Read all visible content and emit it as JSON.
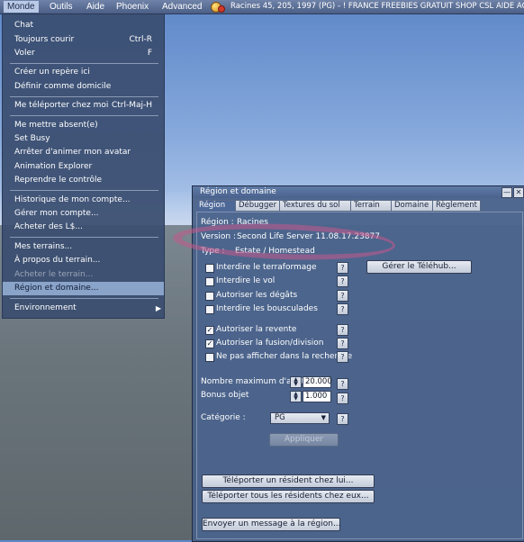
{
  "menubar": {
    "items": [
      "Monde",
      "Outils",
      "Aide",
      "Phoenix",
      "Advanced"
    ],
    "status": "Racines 45, 205, 1997 (PG) - ! FRANCE FREEBIES GRATUIT SHOP CSL AIDE ACCUEIL"
  },
  "monde_menu": {
    "items": [
      {
        "label": "Chat",
        "shortcut": ""
      },
      {
        "label": "Toujours courir",
        "shortcut": "Ctrl-R"
      },
      {
        "label": "Voler",
        "shortcut": "F"
      },
      {
        "label": "Créer un repère ici",
        "shortcut": ""
      },
      {
        "label": "Définir comme domicile",
        "shortcut": ""
      },
      {
        "label": "Me téléporter chez moi",
        "shortcut": "Ctrl-Maj-H"
      },
      {
        "label": "Me mettre absent(e)",
        "shortcut": ""
      },
      {
        "label": "Set Busy",
        "shortcut": ""
      },
      {
        "label": "Arrêter d'animer mon avatar",
        "shortcut": ""
      },
      {
        "label": "Animation Explorer",
        "shortcut": ""
      },
      {
        "label": "Reprendre le contrôle",
        "shortcut": ""
      },
      {
        "label": "Historique de mon compte...",
        "shortcut": ""
      },
      {
        "label": "Gérer mon compte...",
        "shortcut": ""
      },
      {
        "label": "Acheter des L$...",
        "shortcut": ""
      },
      {
        "label": "Mes terrains...",
        "shortcut": ""
      },
      {
        "label": "À propos du terrain...",
        "shortcut": ""
      },
      {
        "label": "Acheter le terrain...",
        "shortcut": ""
      },
      {
        "label": "Région et domaine...",
        "shortcut": ""
      },
      {
        "label": "Environnement",
        "shortcut": ""
      }
    ]
  },
  "floater": {
    "title": "Région et domaine",
    "tabs": [
      "Région",
      "Débugger",
      "Textures du sol",
      "Terrain",
      "Domaine",
      "Règlement"
    ],
    "region_label": "Région :",
    "region_value": "Racines",
    "version_label": "Version :",
    "version_value": "Second Life Server 11.08.17.23877",
    "type_label": "Type :",
    "type_value": "Estate / Homestead",
    "checkboxes": [
      {
        "label": "Interdire le terraformage",
        "checked": false
      },
      {
        "label": "Interdire le vol",
        "checked": false
      },
      {
        "label": "Autoriser les dégâts",
        "checked": false
      },
      {
        "label": "Interdire les bousculades",
        "checked": false
      },
      {
        "label": "Autoriser la revente",
        "checked": true
      },
      {
        "label": "Autoriser la fusion/division",
        "checked": true
      },
      {
        "label": "Ne pas afficher dans la recherche",
        "checked": false
      }
    ],
    "check_mark": "✓",
    "help_glyph": "?",
    "telehub_button": "Gérer le Téléhub...",
    "max_avatars_label": "Nombre maximum d'avat",
    "max_avatars_value": "20.000",
    "bonus_label": "Bonus objet",
    "bonus_value": "1.000",
    "category_label": "Catégorie :",
    "category_value": "PG",
    "apply_button": "Appliquer",
    "tp_resident_button": "Téléporter un résident chez lui...",
    "tp_all_button": "Téléporter tous les résidents chez eux...",
    "message_button": "Envoyer un message à la région...",
    "minimize_glyph": "—",
    "close_glyph": "✕"
  }
}
